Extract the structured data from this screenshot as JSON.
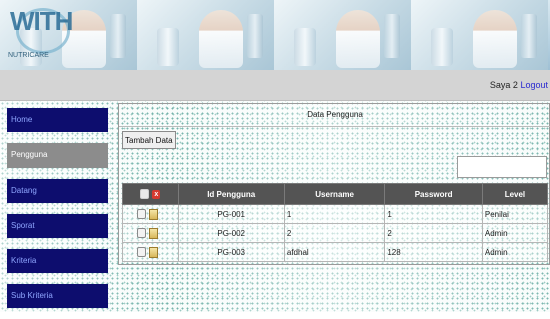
{
  "header": {
    "logo_word": "WITH",
    "logo_subtext": "NUTRICARE"
  },
  "topbar": {
    "welcome_text": "Saya 2",
    "logout_label": "Logout"
  },
  "sidebar": {
    "items": [
      {
        "label": "Home",
        "active": false
      },
      {
        "label": "Pengguna",
        "active": true
      },
      {
        "label": "Datang",
        "active": false
      },
      {
        "label": "Sporat",
        "active": false
      },
      {
        "label": "Kriteria",
        "active": false
      },
      {
        "label": "Sub Kriteria",
        "active": false
      }
    ]
  },
  "main": {
    "title": "Data Pengguna",
    "add_button": "Tambah Data",
    "search_value": ""
  },
  "table": {
    "columns": [
      "",
      "Id Pengguna",
      "Username",
      "Password",
      "Level"
    ],
    "rows": [
      {
        "id": "PG-001",
        "username": "1",
        "password": "1",
        "level": "Penilai"
      },
      {
        "id": "PG-002",
        "username": "2",
        "password": "2",
        "level": "Admin"
      },
      {
        "id": "PG-003",
        "username": "afdhal",
        "password": "128",
        "level": "Admin"
      }
    ]
  },
  "colors": {
    "nav_bg": "#0d0d6e",
    "nav_active_bg": "#8c8c8c",
    "table_header_bg": "#545454",
    "topbar_bg": "#d4d4d4",
    "link": "#2a2ad0"
  }
}
